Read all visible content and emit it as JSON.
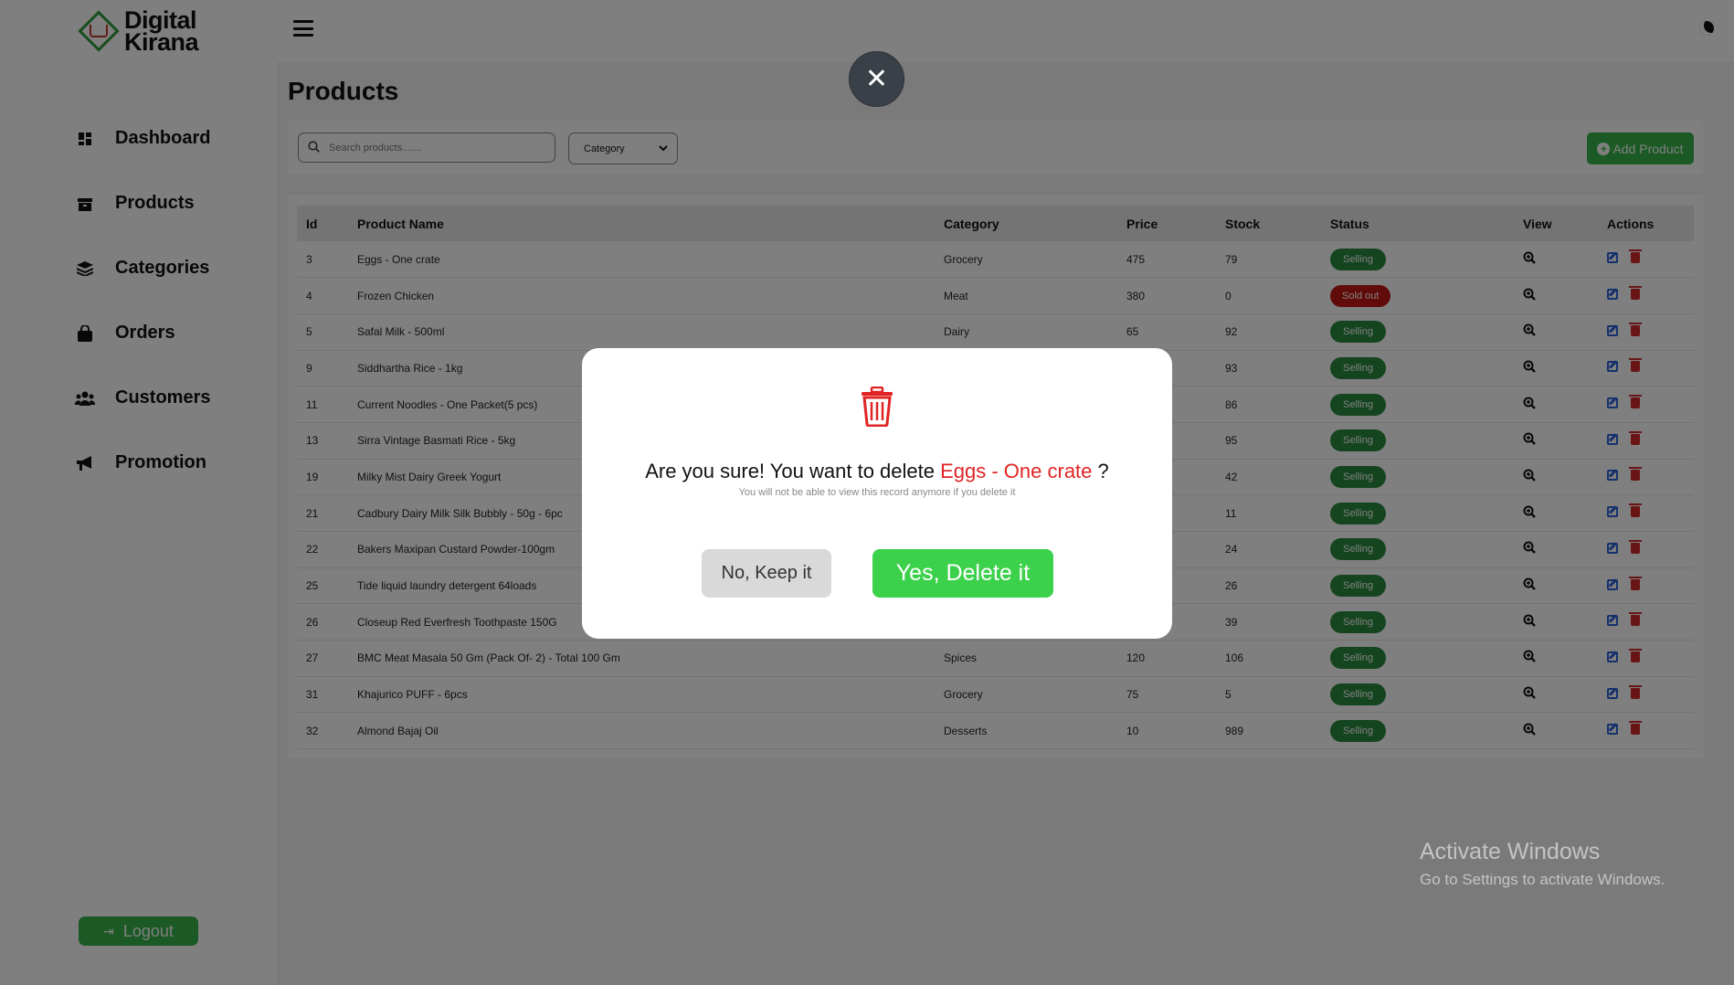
{
  "brand": {
    "line1": "Digital",
    "line2": "Kirana"
  },
  "sidebar": {
    "items": [
      {
        "label": "Dashboard",
        "icon": "dashboard-icon"
      },
      {
        "label": "Products",
        "icon": "box-icon"
      },
      {
        "label": "Categories",
        "icon": "layers-icon"
      },
      {
        "label": "Orders",
        "icon": "bag-icon"
      },
      {
        "label": "Customers",
        "icon": "users-icon"
      },
      {
        "label": "Promotion",
        "icon": "megaphone-icon"
      }
    ],
    "logout_label": "Logout"
  },
  "page": {
    "title": "Products"
  },
  "toolbar": {
    "search_placeholder": "Search products.......",
    "category_select": "Category",
    "add_label": "Add Product"
  },
  "table": {
    "headers": [
      "Id",
      "Product Name",
      "Category",
      "Price",
      "Stock",
      "Status",
      "View",
      "Actions"
    ],
    "rows": [
      {
        "id": "3",
        "name": "Eggs - One crate",
        "category": "Grocery",
        "price": "475",
        "stock": "79",
        "status": "Selling"
      },
      {
        "id": "4",
        "name": "Frozen Chicken",
        "category": "Meat",
        "price": "380",
        "stock": "0",
        "status": "Sold out"
      },
      {
        "id": "5",
        "name": "Safal Milk - 500ml",
        "category": "Dairy",
        "price": "65",
        "stock": "92",
        "status": "Selling"
      },
      {
        "id": "9",
        "name": "Siddhartha Rice - 1kg",
        "category": "",
        "price": "",
        "stock": "93",
        "status": "Selling"
      },
      {
        "id": "11",
        "name": "Current Noodles - One Packet(5 pcs)",
        "category": "",
        "price": "",
        "stock": "86",
        "status": "Selling"
      },
      {
        "id": "13",
        "name": "Sirra Vintage Basmati Rice - 5kg",
        "category": "",
        "price": "",
        "stock": "95",
        "status": "Selling"
      },
      {
        "id": "19",
        "name": "Milky Mist Dairy Greek Yogurt",
        "category": "",
        "price": "",
        "stock": "42",
        "status": "Selling"
      },
      {
        "id": "21",
        "name": "Cadbury Dairy Milk Silk Bubbly - 50g - 6pc",
        "category": "",
        "price": "",
        "stock": "11",
        "status": "Selling"
      },
      {
        "id": "22",
        "name": "Bakers Maxipan Custard Powder-100gm",
        "category": "",
        "price": "",
        "stock": "24",
        "status": "Selling"
      },
      {
        "id": "25",
        "name": "Tide liquid laundry detergent 64loads",
        "category": "",
        "price": "",
        "stock": "26",
        "status": "Selling"
      },
      {
        "id": "26",
        "name": "Closeup Red Everfresh Toothpaste 150G",
        "category": "",
        "price": "",
        "stock": "39",
        "status": "Selling"
      },
      {
        "id": "27",
        "name": "BMC Meat Masala 50 Gm (Pack Of- 2) - Total 100 Gm",
        "category": "Spices",
        "price": "120",
        "stock": "106",
        "status": "Selling"
      },
      {
        "id": "31",
        "name": "Khajurico PUFF - 6pcs",
        "category": "Grocery",
        "price": "75",
        "stock": "5",
        "status": "Selling"
      },
      {
        "id": "32",
        "name": "Almond Bajaj Oil",
        "category": "Desserts",
        "price": "10",
        "stock": "989",
        "status": "Selling"
      }
    ]
  },
  "modal": {
    "message_prefix": "Are you sure! You want to delete",
    "item_name": "Eggs - One crate",
    "message_suffix": "?",
    "subtext": "You will not be able to view this record anymore if you delete it",
    "cancel_label": "No, Keep it",
    "confirm_label": "Yes, Delete it"
  },
  "watermark": {
    "line1": "Activate Windows",
    "line2": "Go to Settings to activate Windows."
  },
  "colors": {
    "primary_green": "#39b54a",
    "sold_out_red": "#c41717",
    "danger_red": "#e02424"
  }
}
